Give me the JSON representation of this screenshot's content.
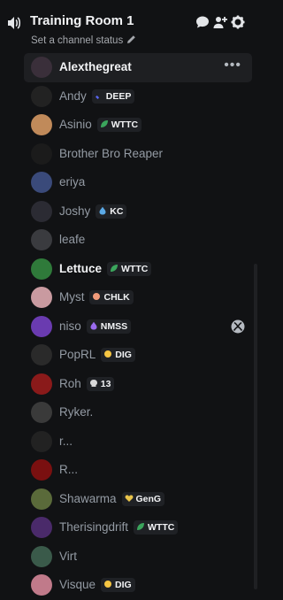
{
  "channel": {
    "name": "Training Room 1",
    "status_placeholder": "Set a channel status"
  },
  "members": [
    {
      "name": "Alexthegreat",
      "bright": true,
      "active": true,
      "avatar_color": "#3a2f3a"
    },
    {
      "name": "Andy",
      "tag": "DEEP",
      "tag_icon": "blade-icon",
      "tag_color": "#5865f2",
      "avatar_color": "#222"
    },
    {
      "name": "Asinio",
      "tag": "WTTC",
      "tag_icon": "leaf-icon",
      "tag_color": "#3ba55c",
      "avatar_color": "#c08a5a"
    },
    {
      "name": "Brother Bro Reaper",
      "avatar_color": "#1b1b1b"
    },
    {
      "name": "eriya",
      "avatar_color": "#3a4a7a"
    },
    {
      "name": "Joshy",
      "tag": "KC",
      "tag_icon": "drop-icon",
      "tag_color": "#5aa9e6",
      "avatar_color": "#2b2b33"
    },
    {
      "name": "leafe",
      "avatar_color": "#3a3b3f"
    },
    {
      "name": "Lettuce",
      "bright": true,
      "tag": "WTTC",
      "tag_icon": "leaf-icon",
      "tag_color": "#3ba55c",
      "avatar_color": "#2f7a3a"
    },
    {
      "name": "Myst",
      "tag": "CHLK",
      "tag_icon": "cake-icon",
      "tag_color": "#f09a7a",
      "avatar_color": "#c99aa0"
    },
    {
      "name": "niso",
      "tag": "NMSS",
      "tag_icon": "flame-icon",
      "tag_color": "#9b6cf0",
      "avatar_color": "#6a3bb0",
      "xbox": true
    },
    {
      "name": "PopRL",
      "tag": "DIG",
      "tag_icon": "hand-icon",
      "tag_color": "#f5c542",
      "avatar_color": "#2a2a2a"
    },
    {
      "name": "Roh",
      "tag": "13",
      "tag_icon": "skull-icon",
      "tag_color": "#d9d9d9",
      "avatar_color": "#8a1a1a"
    },
    {
      "name": "Ryker.",
      "avatar_color": "#3a3a3a"
    },
    {
      "name": "r...",
      "avatar_color": "#222"
    },
    {
      "name": "R...",
      "avatar_color": "#7a1010"
    },
    {
      "name": "Shawarma",
      "tag": "GenG",
      "tag_icon": "heart-icon",
      "tag_color": "#e8c34a",
      "avatar_color": "#5a6a3a"
    },
    {
      "name": "Therisingdrift",
      "tag": "WTTC",
      "tag_icon": "leaf-icon",
      "tag_color": "#3ba55c",
      "avatar_color": "#4a2a6a"
    },
    {
      "name": "Virt",
      "avatar_color": "#3a5a4a"
    },
    {
      "name": "Visque",
      "tag": "DIG",
      "tag_icon": "hand-icon",
      "tag_color": "#f5c542",
      "avatar_color": "#c07a8a"
    }
  ]
}
